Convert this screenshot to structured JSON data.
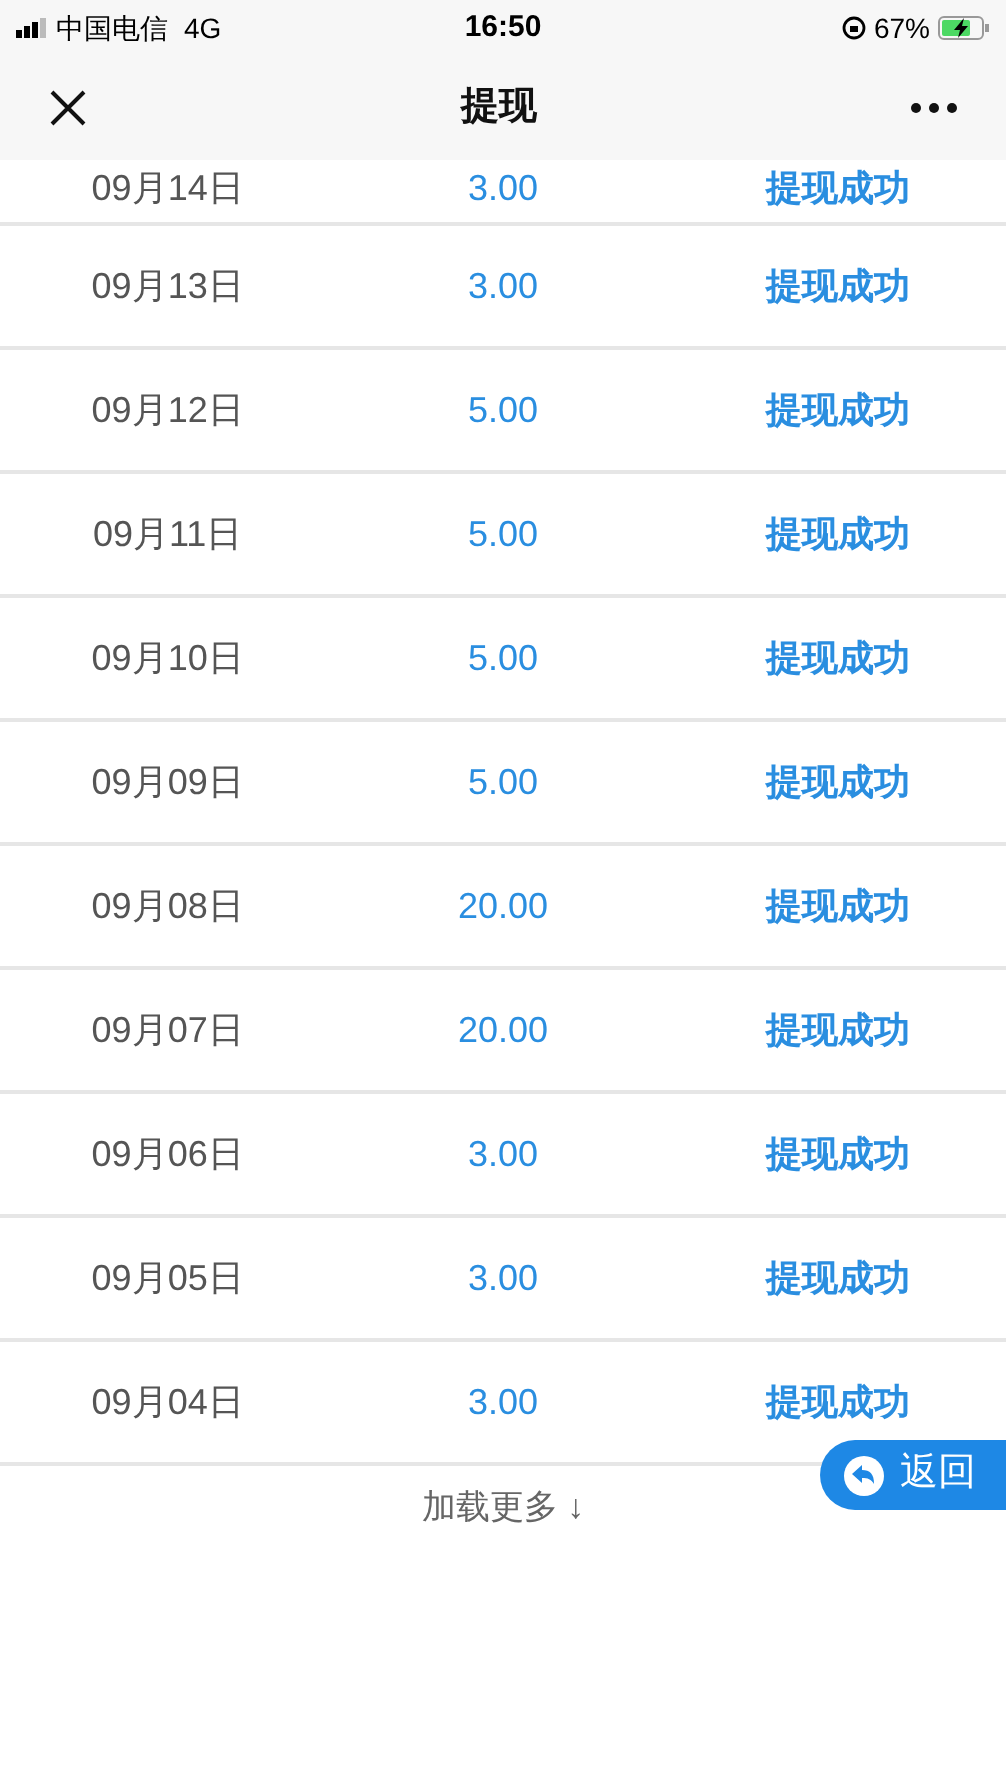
{
  "status_bar": {
    "carrier": "中国电信",
    "network": "4G",
    "time": "16:50",
    "battery": "67%"
  },
  "header": {
    "title": "提现"
  },
  "records": [
    {
      "date": "09月14日",
      "amount": "3.00",
      "status": "提现成功"
    },
    {
      "date": "09月13日",
      "amount": "3.00",
      "status": "提现成功"
    },
    {
      "date": "09月12日",
      "amount": "5.00",
      "status": "提现成功"
    },
    {
      "date": "09月11日",
      "amount": "5.00",
      "status": "提现成功"
    },
    {
      "date": "09月10日",
      "amount": "5.00",
      "status": "提现成功"
    },
    {
      "date": "09月09日",
      "amount": "5.00",
      "status": "提现成功"
    },
    {
      "date": "09月08日",
      "amount": "20.00",
      "status": "提现成功"
    },
    {
      "date": "09月07日",
      "amount": "20.00",
      "status": "提现成功"
    },
    {
      "date": "09月06日",
      "amount": "3.00",
      "status": "提现成功"
    },
    {
      "date": "09月05日",
      "amount": "3.00",
      "status": "提现成功"
    },
    {
      "date": "09月04日",
      "amount": "3.00",
      "status": "提现成功"
    }
  ],
  "load_more": {
    "label": "加载更多 ↓"
  },
  "back_button": {
    "label": "返回"
  }
}
